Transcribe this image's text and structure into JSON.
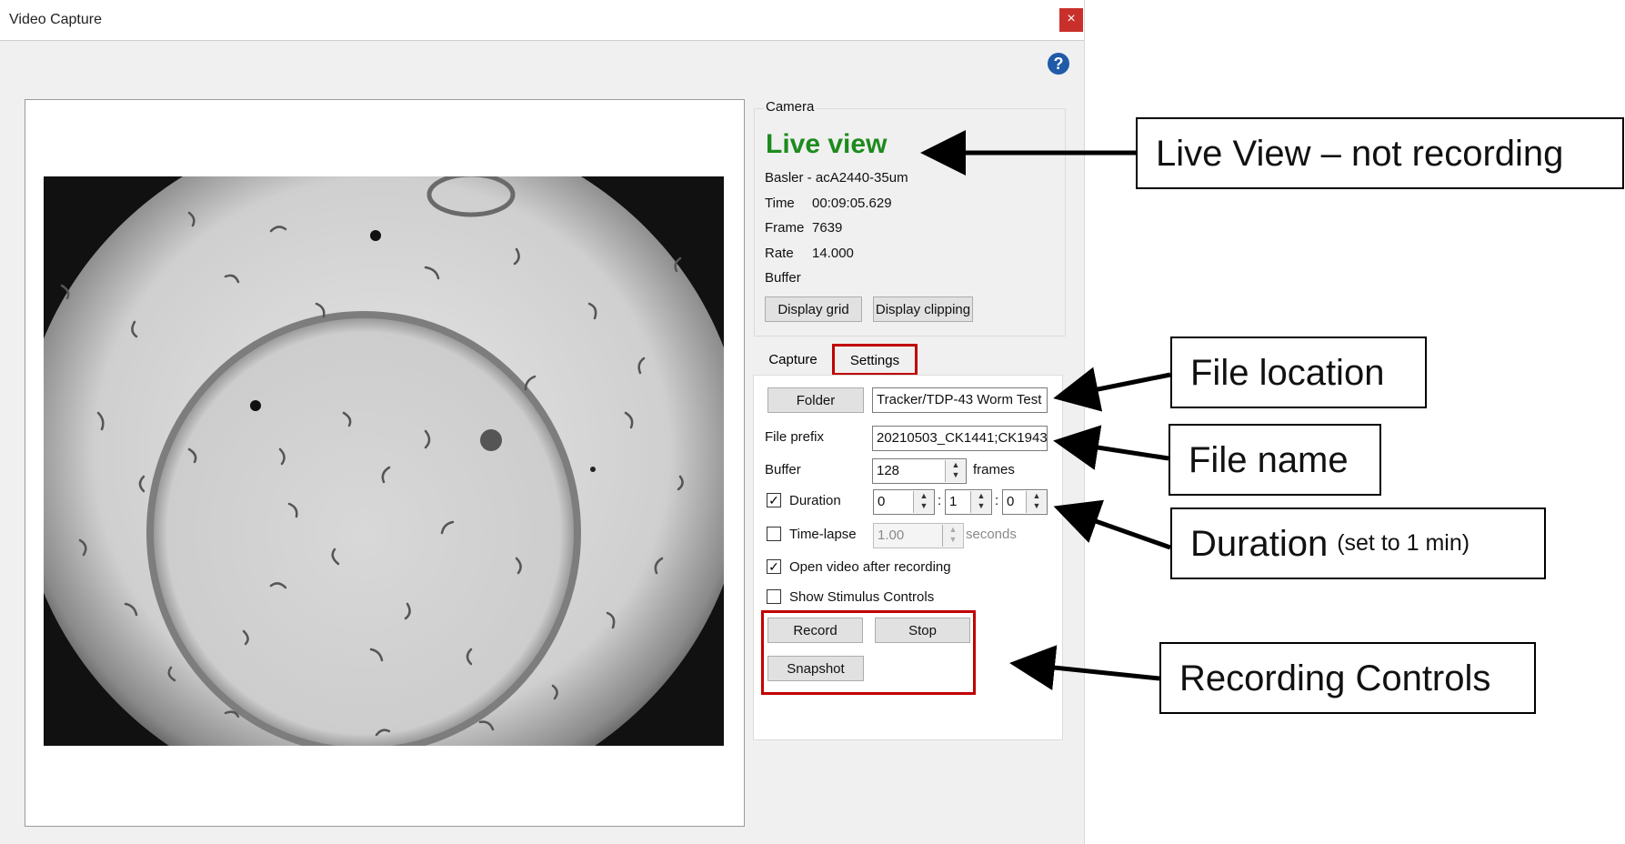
{
  "window": {
    "title": "Video Capture",
    "close_icon": "×",
    "help_icon": "?"
  },
  "camera": {
    "group_label": "Camera",
    "status": "Live view",
    "status_color": "#1e8a1e",
    "model": "Basler - acA2440-35um",
    "time_label": "Time",
    "time_value": "00:09:05.629",
    "frame_label": "Frame",
    "frame_value": "7639",
    "rate_label": "Rate",
    "rate_value": "14.000",
    "buffer_label": "Buffer",
    "display_grid_label": "Display grid",
    "display_clipping_label": "Display clipping"
  },
  "tabs": [
    {
      "label": "Capture",
      "active": true
    },
    {
      "label": "Settings",
      "active": false
    }
  ],
  "capture": {
    "folder_label": "Folder",
    "folder_value": "Tracker/TDP-43 Worm Test",
    "file_prefix_label": "File prefix",
    "file_prefix_value": "20210503_CK1441;CK1943",
    "buffer_label": "Buffer",
    "buffer_value": "128",
    "buffer_unit": "frames",
    "duration_label": "Duration",
    "duration_checked": true,
    "duration_h": "0",
    "duration_m": "1",
    "duration_s": "0",
    "colon": ":",
    "timelapse_label": "Time-lapse",
    "timelapse_checked": false,
    "timelapse_value": "1.00",
    "timelapse_unit": "seconds",
    "open_video_label": "Open video after recording",
    "open_video_checked": true,
    "stimulus_label": "Show Stimulus Controls",
    "stimulus_checked": false,
    "record_label": "Record",
    "stop_label": "Stop",
    "snapshot_label": "Snapshot"
  },
  "annotations": {
    "live_view": "Live View – not recording",
    "file_location": "File location",
    "file_name": "File name",
    "duration": "Duration",
    "duration_note": "(set to 1 min)",
    "recording_controls": "Recording Controls"
  },
  "colors": {
    "highlight_red": "#c00000",
    "close_red": "#c9302c",
    "help_blue": "#1f5ba8"
  }
}
